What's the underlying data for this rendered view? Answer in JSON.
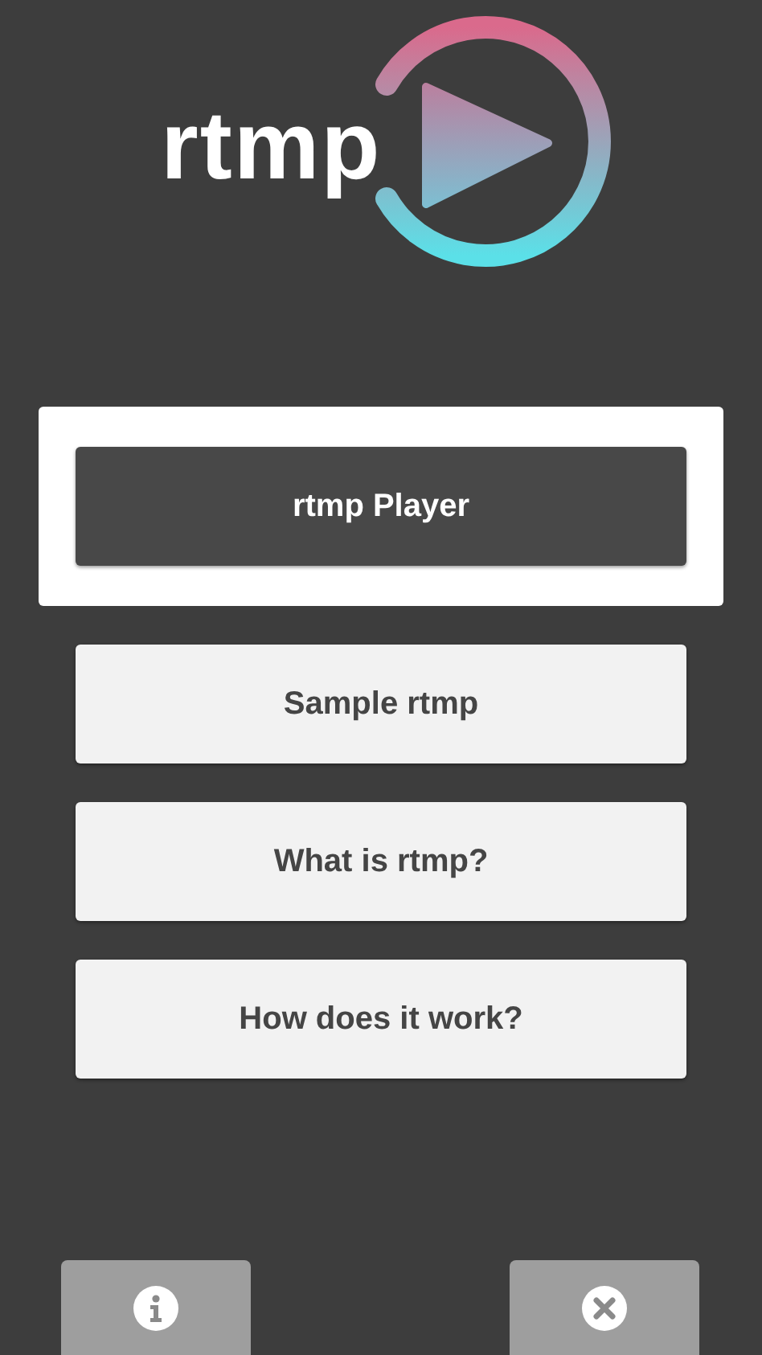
{
  "logo": {
    "text": "rtmp"
  },
  "menu": [
    {
      "label": "rtmp Player",
      "selected": true
    },
    {
      "label": "Sample rtmp",
      "selected": false
    },
    {
      "label": "What is rtmp?",
      "selected": false
    },
    {
      "label": "How does it work?",
      "selected": false
    }
  ],
  "bottom_buttons": [
    {
      "kind": "info"
    },
    {
      "kind": "close"
    }
  ]
}
